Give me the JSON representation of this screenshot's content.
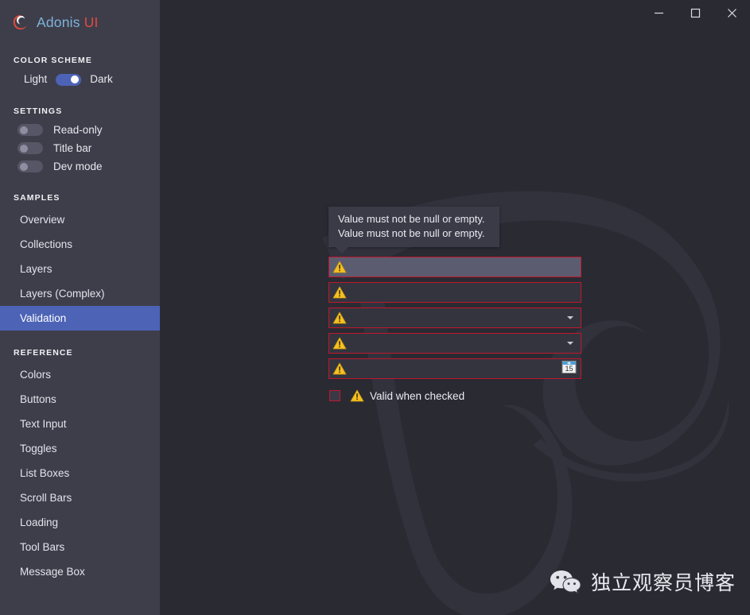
{
  "app": {
    "logo_primary": "Adonis",
    "logo_secondary": "UI",
    "accent_blue": "#4c63b6",
    "error_red": "#c0172b",
    "warn_yellow": "#f5c022",
    "sidebar_bg": "#3e3e4b",
    "content_bg": "#2a2a33"
  },
  "titlebar": {
    "minimize_label": "Minimize",
    "maximize_label": "Maximize",
    "close_label": "Close"
  },
  "sidebar": {
    "color_scheme": {
      "heading": "COLOR SCHEME",
      "left_label": "Light",
      "right_label": "Dark",
      "value": "Dark"
    },
    "settings": {
      "heading": "SETTINGS",
      "items": [
        {
          "label": "Read-only",
          "on": false
        },
        {
          "label": "Title bar",
          "on": false
        },
        {
          "label": "Dev mode",
          "on": false
        }
      ]
    },
    "samples": {
      "heading": "SAMPLES",
      "items": [
        {
          "label": "Overview",
          "active": false
        },
        {
          "label": "Collections",
          "active": false
        },
        {
          "label": "Layers",
          "active": false
        },
        {
          "label": "Layers (Complex)",
          "active": false
        },
        {
          "label": "Validation",
          "active": true
        }
      ]
    },
    "reference": {
      "heading": "REFERENCE",
      "items": [
        {
          "label": "Colors"
        },
        {
          "label": "Buttons"
        },
        {
          "label": "Text Input"
        },
        {
          "label": "Toggles"
        },
        {
          "label": "List Boxes"
        },
        {
          "label": "Scroll Bars"
        },
        {
          "label": "Loading"
        },
        {
          "label": "Tool Bars"
        },
        {
          "label": "Message Box"
        }
      ]
    }
  },
  "main": {
    "tooltip": {
      "line1": "Value must not be null or empty.",
      "line2": "Value must not be null or empty."
    },
    "fields": [
      {
        "kind": "textbox",
        "value": "",
        "invalid": true,
        "hovered": true
      },
      {
        "kind": "textbox",
        "value": "",
        "invalid": true,
        "hovered": false
      },
      {
        "kind": "combobox",
        "value": "",
        "invalid": true,
        "hovered": false
      },
      {
        "kind": "combobox",
        "value": "",
        "invalid": true,
        "hovered": false
      },
      {
        "kind": "datepicker",
        "value": "",
        "invalid": true,
        "hovered": false,
        "calendar_day": "15"
      }
    ],
    "checkbox": {
      "label": "Valid when checked",
      "checked": false,
      "invalid": true
    }
  },
  "watermark": {
    "icon": "wechat-icon",
    "text": "独立观察员博客"
  }
}
